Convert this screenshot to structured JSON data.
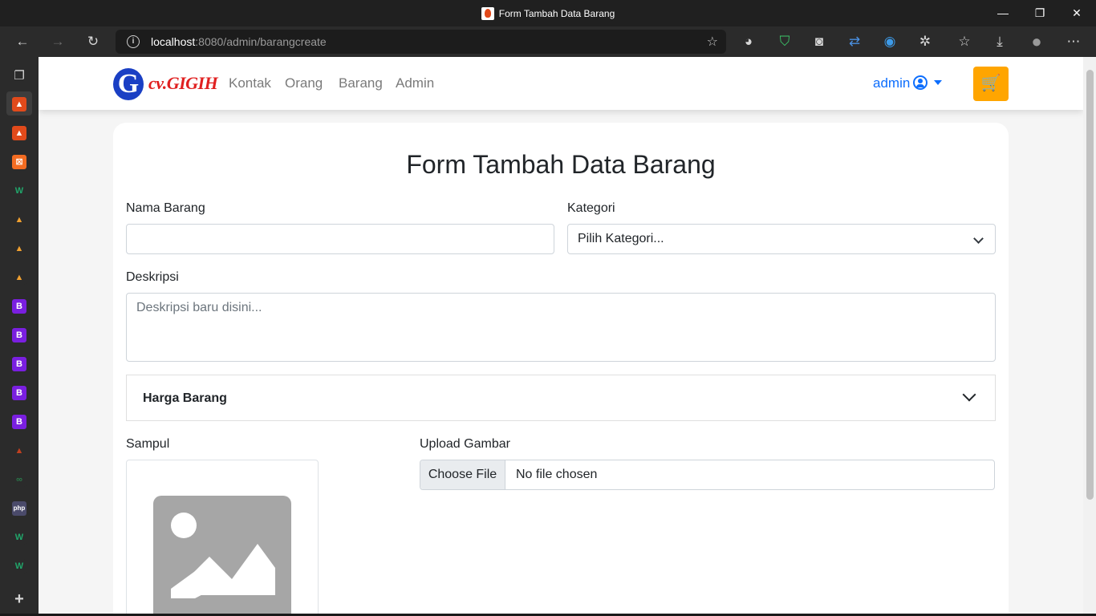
{
  "window": {
    "title": "Form Tambah Data Barang",
    "minimize": "—",
    "restore": "❐",
    "close": "✕"
  },
  "toolbar": {
    "back": "←",
    "forward": "→",
    "reload": "↻",
    "url_host": "localhost",
    "url_rest": ":8080/admin/barangcreate",
    "extensions": [
      "◕",
      "⛉",
      "◙",
      "⇄",
      "◉",
      "✲",
      "☆",
      "⤓",
      "●",
      "⋯"
    ]
  },
  "tabstrip": {
    "top_icon": "❐",
    "tabs": [
      {
        "glyph": "▲",
        "bg": "#e14a1b"
      },
      {
        "glyph": "▲",
        "bg": "#e14a1b"
      },
      {
        "glyph": "⊠",
        "bg": "#f36c22"
      },
      {
        "glyph": "W",
        "bg": "#2b2b2b",
        "fg": "#21a66b"
      },
      {
        "glyph": "▲",
        "bg": "#2b2b2b",
        "fg": "#f0a030"
      },
      {
        "glyph": "▲",
        "bg": "#2b2b2b",
        "fg": "#f0a030"
      },
      {
        "glyph": "▲",
        "bg": "#2b2b2b",
        "fg": "#f0a030"
      },
      {
        "glyph": "B",
        "bg": "#7a1fe0"
      },
      {
        "glyph": "B",
        "bg": "#7a1fe0"
      },
      {
        "glyph": "B",
        "bg": "#7a1fe0"
      },
      {
        "glyph": "B",
        "bg": "#7a1fe0"
      },
      {
        "glyph": "B",
        "bg": "#7a1fe0"
      },
      {
        "glyph": "▲",
        "bg": "#2b2b2b",
        "fg": "#c04020"
      },
      {
        "glyph": "∞",
        "bg": "#2b2b2b",
        "fg": "#2a7a4a"
      },
      {
        "glyph": "php",
        "bg": "#4a4a6a"
      },
      {
        "glyph": "W",
        "bg": "#2b2b2b",
        "fg": "#21a66b"
      },
      {
        "glyph": "W",
        "bg": "#2b2b2b",
        "fg": "#21a66b"
      }
    ],
    "new_tab": "+"
  },
  "navbar": {
    "brand_letter": "G",
    "brand_text": "cv.GIGIH",
    "links": [
      "Kontak",
      "Orang",
      "Barang",
      "Admin"
    ],
    "user": "admin",
    "cart_icon": "🛒"
  },
  "form": {
    "title": "Form Tambah Data Barang",
    "nama_label": "Nama Barang",
    "nama_value": "",
    "kategori_label": "Kategori",
    "kategori_selected": "Pilih Kategori...",
    "deskripsi_label": "Deskripsi",
    "deskripsi_placeholder": "Deskripsi baru disini...",
    "harga_label": "Harga Barang",
    "sampul_label": "Sampul",
    "upload_label": "Upload Gambar",
    "choose_file": "Choose File",
    "file_status": "No file chosen"
  },
  "colors": {
    "primary": "#0d6efd",
    "cart": "#ffa500",
    "placeholder_image": "#a6a6a6"
  }
}
